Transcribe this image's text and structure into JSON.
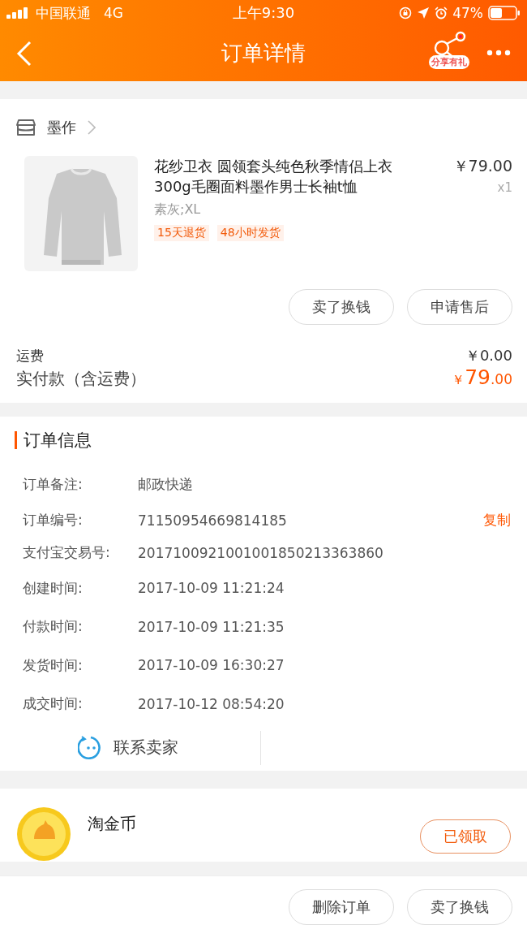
{
  "status_bar": {
    "carrier": "中国联通",
    "network": "4G",
    "time": "上午9:30",
    "battery": "47%"
  },
  "nav": {
    "title": "订单详情",
    "share_label": "分享有礼"
  },
  "shop": {
    "name": "墨作"
  },
  "item": {
    "title": "花纱卫衣 圆领套头纯色秋季情侣上衣300g毛圈面料墨作男士长袖t恤",
    "price": "￥79.00",
    "quantity": "x1",
    "sku": "素灰;XL",
    "tags": [
      "15天退货",
      "48小时发货"
    ],
    "buttons": [
      "卖了换钱",
      "申请售后"
    ]
  },
  "totals": {
    "shipping_label": "运费",
    "shipping_value": "￥0.00",
    "paid_label": "实付款（含运费）",
    "paid_currency": "￥",
    "paid_int": "79",
    "paid_dec": ".00"
  },
  "order_info": {
    "title": "订单信息",
    "rows": [
      {
        "label": "订单备注:",
        "value": "邮政快递"
      },
      {
        "label": "订单编号:",
        "value": "71150954669814185",
        "action": "复制"
      },
      {
        "label": "支付宝交易号:",
        "value": "2017100921001001850213363860"
      },
      {
        "label": "创建时间:",
        "value": "2017-10-09 11:21:24"
      },
      {
        "label": "付款时间:",
        "value": "2017-10-09 11:21:35"
      },
      {
        "label": "发货时间:",
        "value": "2017-10-09 16:30:27"
      },
      {
        "label": "成交时间:",
        "value": "2017-10-12 08:54:20"
      }
    ],
    "contact": "联系卖家"
  },
  "coin": {
    "title": "淘金币",
    "button": "已领取"
  },
  "bottom_buttons": [
    "删除订单",
    "卖了换钱"
  ]
}
